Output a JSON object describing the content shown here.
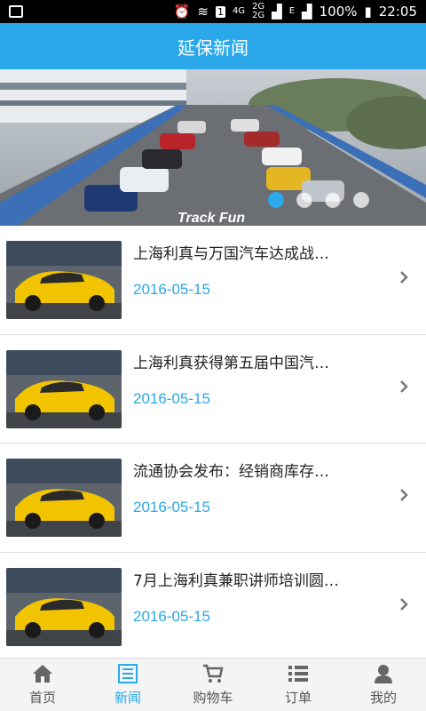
{
  "status_bar": {
    "network": "4G",
    "signal_tags": [
      "2G",
      "2G"
    ],
    "e_tag": "E",
    "sim": "1",
    "battery": "100%",
    "time": "22:05"
  },
  "app_bar": {
    "title": "延保新闻"
  },
  "banner": {
    "watermark": "Track Fun",
    "slides": 4,
    "active_slide": 1
  },
  "news": [
    {
      "title": "上海利真与万国汽车达成战…",
      "date": "2016-05-15"
    },
    {
      "title": "上海利真获得第五届中国汽…",
      "date": "2016-05-15"
    },
    {
      "title": "流通协会发布：经销商库存…",
      "date": "2016-05-15"
    },
    {
      "title": "7月上海利真兼职讲师培训圆…",
      "date": "2016-05-15"
    }
  ],
  "tabs": [
    {
      "label": "首页",
      "icon": "home-icon"
    },
    {
      "label": "新闻",
      "icon": "news-icon"
    },
    {
      "label": "购物车",
      "icon": "cart-icon"
    },
    {
      "label": "订单",
      "icon": "order-list-icon"
    },
    {
      "label": "我的",
      "icon": "user-icon"
    }
  ],
  "active_tab": 1,
  "colors": {
    "accent": "#2aa8ea",
    "status_bar": "#000000",
    "tab_bar": "#f4f4f4"
  }
}
